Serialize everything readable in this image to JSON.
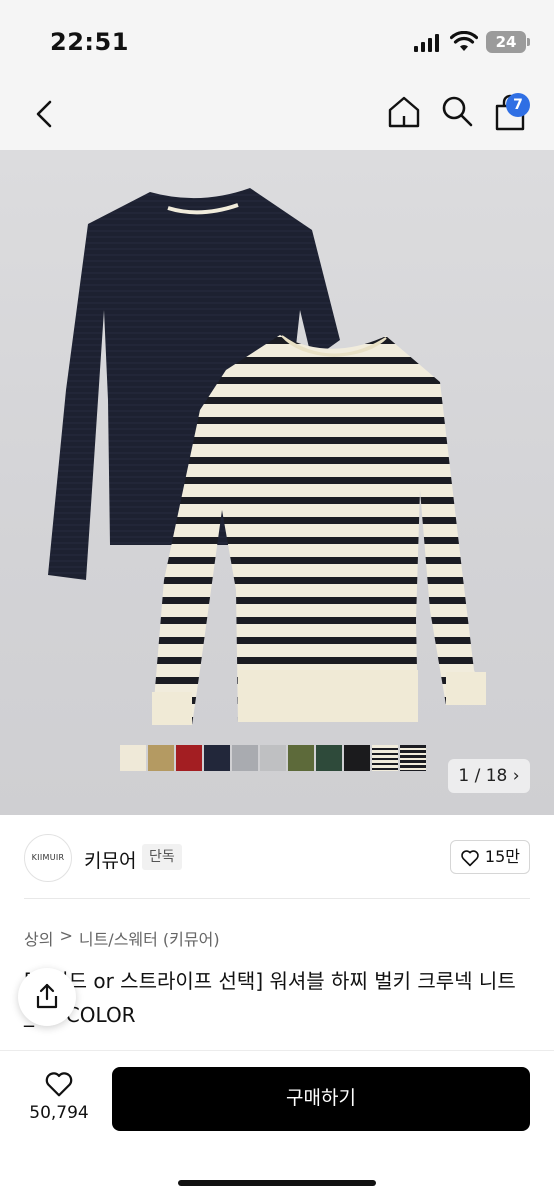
{
  "status_bar": {
    "time": "22:51",
    "battery": "24"
  },
  "nav": {
    "cart_count": "7"
  },
  "product_image": {
    "counter": "1 / 18",
    "swatch_colors": [
      "#efe9d8",
      "#b49a62",
      "#a31e22",
      "#22273a",
      "#a9abb0",
      "#bfc0c2",
      "#5d6a3a",
      "#2e4a3a",
      "#1b1b1d",
      "stripe-cream",
      "stripe-navy"
    ]
  },
  "brand": {
    "logo_text": "KIIMUIR",
    "name": "키뮤어",
    "tag": "단독",
    "likes": "15만"
  },
  "breadcrumb": {
    "category": "상의",
    "separator": ">",
    "subcategory": "니트/스웨터 (키뮤어)"
  },
  "product": {
    "title": "[솔리드 or 스트라이프 선택] 워셔블 하찌 벌키 크루넥 니트_10 COLOR"
  },
  "bottom_bar": {
    "like_count": "50,794",
    "buy_label": "구매하기"
  },
  "colors": {
    "accent_badge": "#2f6fe4",
    "buy_button": "#000000"
  },
  "icons": {
    "back": "chevron-left-icon",
    "home": "home-icon",
    "search": "search-icon",
    "cart": "shopping-bag-icon",
    "share": "share-icon",
    "heart": "heart-icon"
  }
}
